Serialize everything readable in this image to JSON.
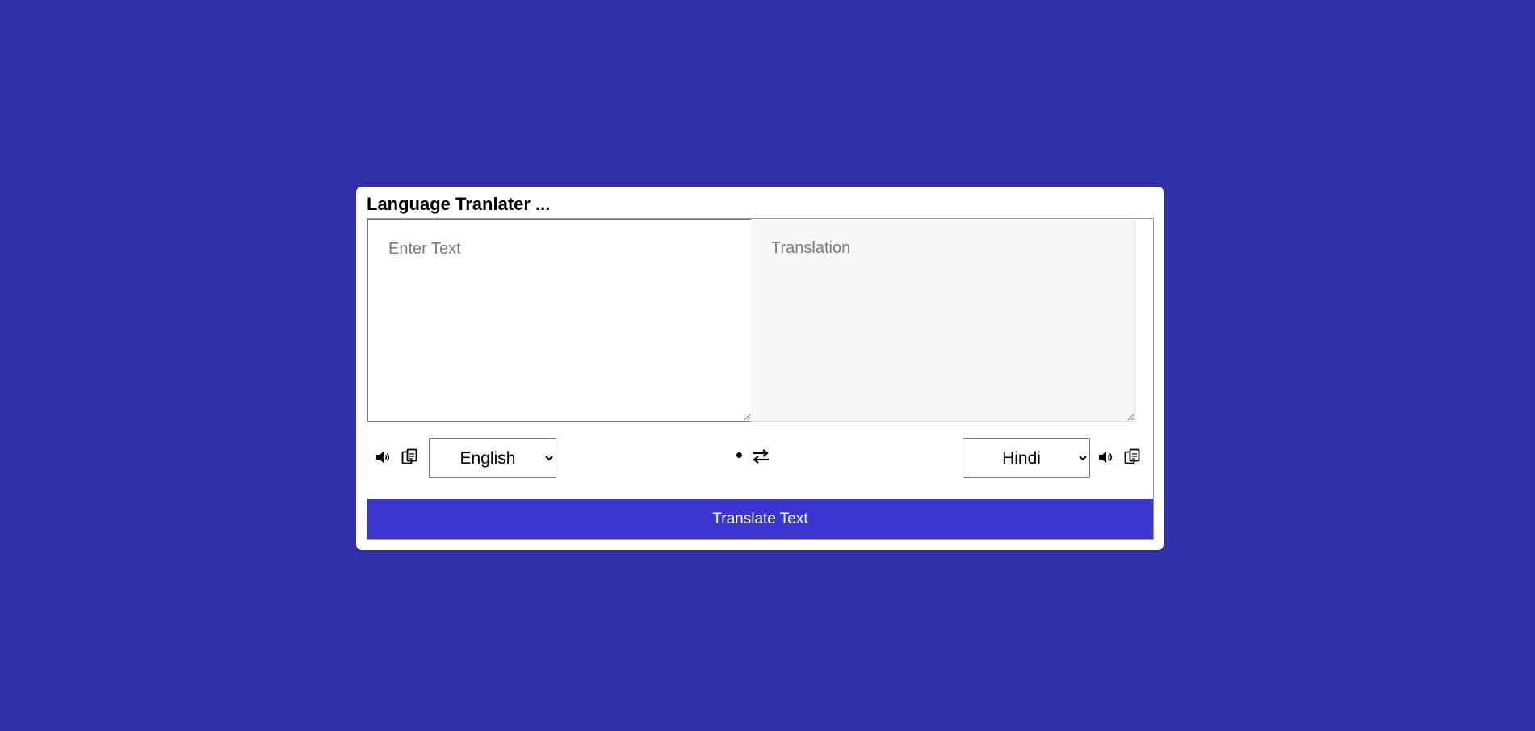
{
  "app": {
    "title": "Language Tranlater ..."
  },
  "input": {
    "placeholder": "Enter Text",
    "value": ""
  },
  "output": {
    "placeholder": "Translation",
    "value": ""
  },
  "controls": {
    "from_language": "English",
    "to_language": "Hindi",
    "from_icons": [
      "volume-icon",
      "copy-icon"
    ],
    "to_icons": [
      "volume-icon",
      "copy-icon"
    ],
    "exchange_icon": "exchange-icon"
  },
  "translate_button": {
    "label": "Translate Text"
  },
  "colors": {
    "background": "#3030a8",
    "card": "#ffffff",
    "button": "#3b35d2",
    "output_bg": "#f7f7f7"
  }
}
